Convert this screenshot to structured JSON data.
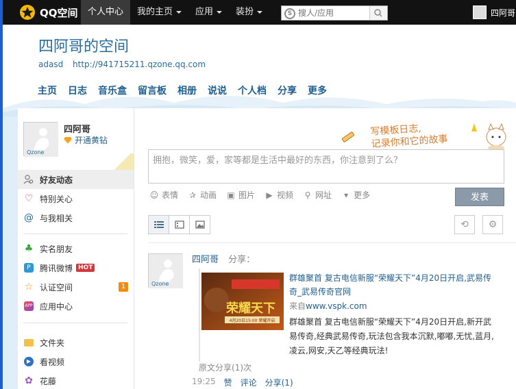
{
  "app": {
    "logo_text": "QQ空间"
  },
  "top_nav": [
    {
      "label": "个人中心",
      "active": true,
      "caret": false
    },
    {
      "label": "我的主页",
      "active": false,
      "caret": true
    },
    {
      "label": "应用",
      "active": false,
      "caret": true
    },
    {
      "label": "装扮",
      "active": false,
      "caret": true
    }
  ],
  "search": {
    "placeholder": "搜人/应用"
  },
  "user": {
    "name": "四阿哥"
  },
  "space": {
    "title": "四阿哥的空间",
    "subtitle": "adasd",
    "url": "http://941715211.qzone.qq.com"
  },
  "main_nav": [
    "主页",
    "日志",
    "音乐盒",
    "留言板",
    "相册",
    "说说",
    "个人档",
    "分享",
    "更多"
  ],
  "sidebar": {
    "name": "四阿哥",
    "vip_link": "开通黄钻",
    "avatar_brand": "Qzone",
    "items": [
      {
        "label": "好友动态",
        "icon": "friends-icon"
      },
      {
        "label": "特别关心",
        "icon": "heart-icon"
      },
      {
        "label": "与我相关",
        "icon": "at-icon"
      },
      {
        "label": "实名朋友",
        "icon": "clover-icon"
      },
      {
        "label": "腾讯微博",
        "icon": "weibo-icon",
        "tag": "HOT"
      },
      {
        "label": "认证空间",
        "icon": "star-icon",
        "badge": "1"
      },
      {
        "label": "应用中心",
        "icon": "app-icon"
      },
      {
        "label": "文件夹",
        "icon": "folder-icon"
      },
      {
        "label": "看视频",
        "icon": "video-icon"
      },
      {
        "label": "花藤",
        "icon": "flower-icon"
      }
    ]
  },
  "composer": {
    "deco_line1": "写模板日志,",
    "deco_line2": "记录你和它的故事",
    "placeholder": "拥抱，微笑，爱，家等都是生活中最好的东西，你注意到了么？",
    "tools": [
      "表情",
      "动画",
      "图片",
      "视频",
      "网址",
      "更多"
    ],
    "post_label": "发表"
  },
  "feed": {
    "author": "四阿哥",
    "action": "分享：",
    "share_title": "群雄聚首 复古电信新服“荣耀天下”4月20日开启,武易传奇_武易传奇官网",
    "source_prefix": "来自",
    "source_url": "www.vspk.com",
    "share_desc": "群雄聚首 复古电信新服“荣耀天下”4月20日开启,新开武易传奇,经典武易传奇,玩法包含我本沉默,嘟嘟,无忧,蓝月,凌云,网安,天乙等经典玩法!",
    "image_caption": "荣耀天下",
    "image_banner": "4月20日15:00 荣耀开启",
    "orig_share": "原文分享(1)次",
    "time": "19:25",
    "actions": [
      "赞",
      "评论",
      "分享(1)"
    ]
  },
  "colors": {
    "accent": "#1f5f90",
    "topbar": "#121212",
    "post_button": "#8a9aa8"
  }
}
